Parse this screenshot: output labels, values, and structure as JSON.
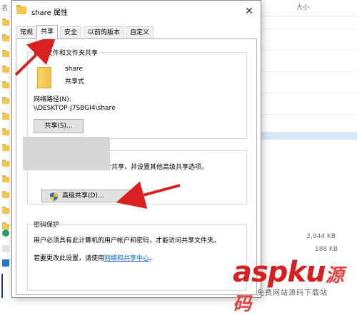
{
  "background_window": {
    "col_name": "名",
    "col_size": "大小",
    "rows": [
      {
        "size": "2,944 KB"
      },
      {
        "size": "188 KB"
      }
    ]
  },
  "dialog": {
    "title": "share 属性",
    "close_glyph": "✕",
    "tabs": [
      {
        "label": "常规"
      },
      {
        "label": "共享"
      },
      {
        "label": "安全"
      },
      {
        "label": "以前的版本"
      },
      {
        "label": "自定义"
      }
    ],
    "active_tab": "共享",
    "network_share": {
      "legend": "网络文件和文件夹共享",
      "folder_name": "share",
      "folder_status": "共享式",
      "path_label": "网络路径(N):",
      "path_value": "\\\\DESKTOP-J7SBGI4\\share",
      "share_button": "共享(S)..."
    },
    "advanced_share": {
      "description": "个共享，并设置其他高级共享选项。",
      "button": "高级共享(D)..."
    },
    "password_protect": {
      "legend": "密码保护",
      "line1": "用户必须具有此计算机的用户帐户和密码，才能访问共享文件夹。",
      "line2_prefix": "若要更改此设置，请使用",
      "line2_link": "网络和共享中心",
      "line2_suffix": "。"
    }
  },
  "watermark": {
    "logo_text": "aspku",
    "logo_cn": "源码",
    "sub_text": "免费网站源码下载站"
  },
  "colors": {
    "arrow": "#d92020",
    "link": "#0066cc",
    "folder": "#f2c94c"
  },
  "icons": [
    "folder-icon",
    "close-icon",
    "shield-icon"
  ]
}
